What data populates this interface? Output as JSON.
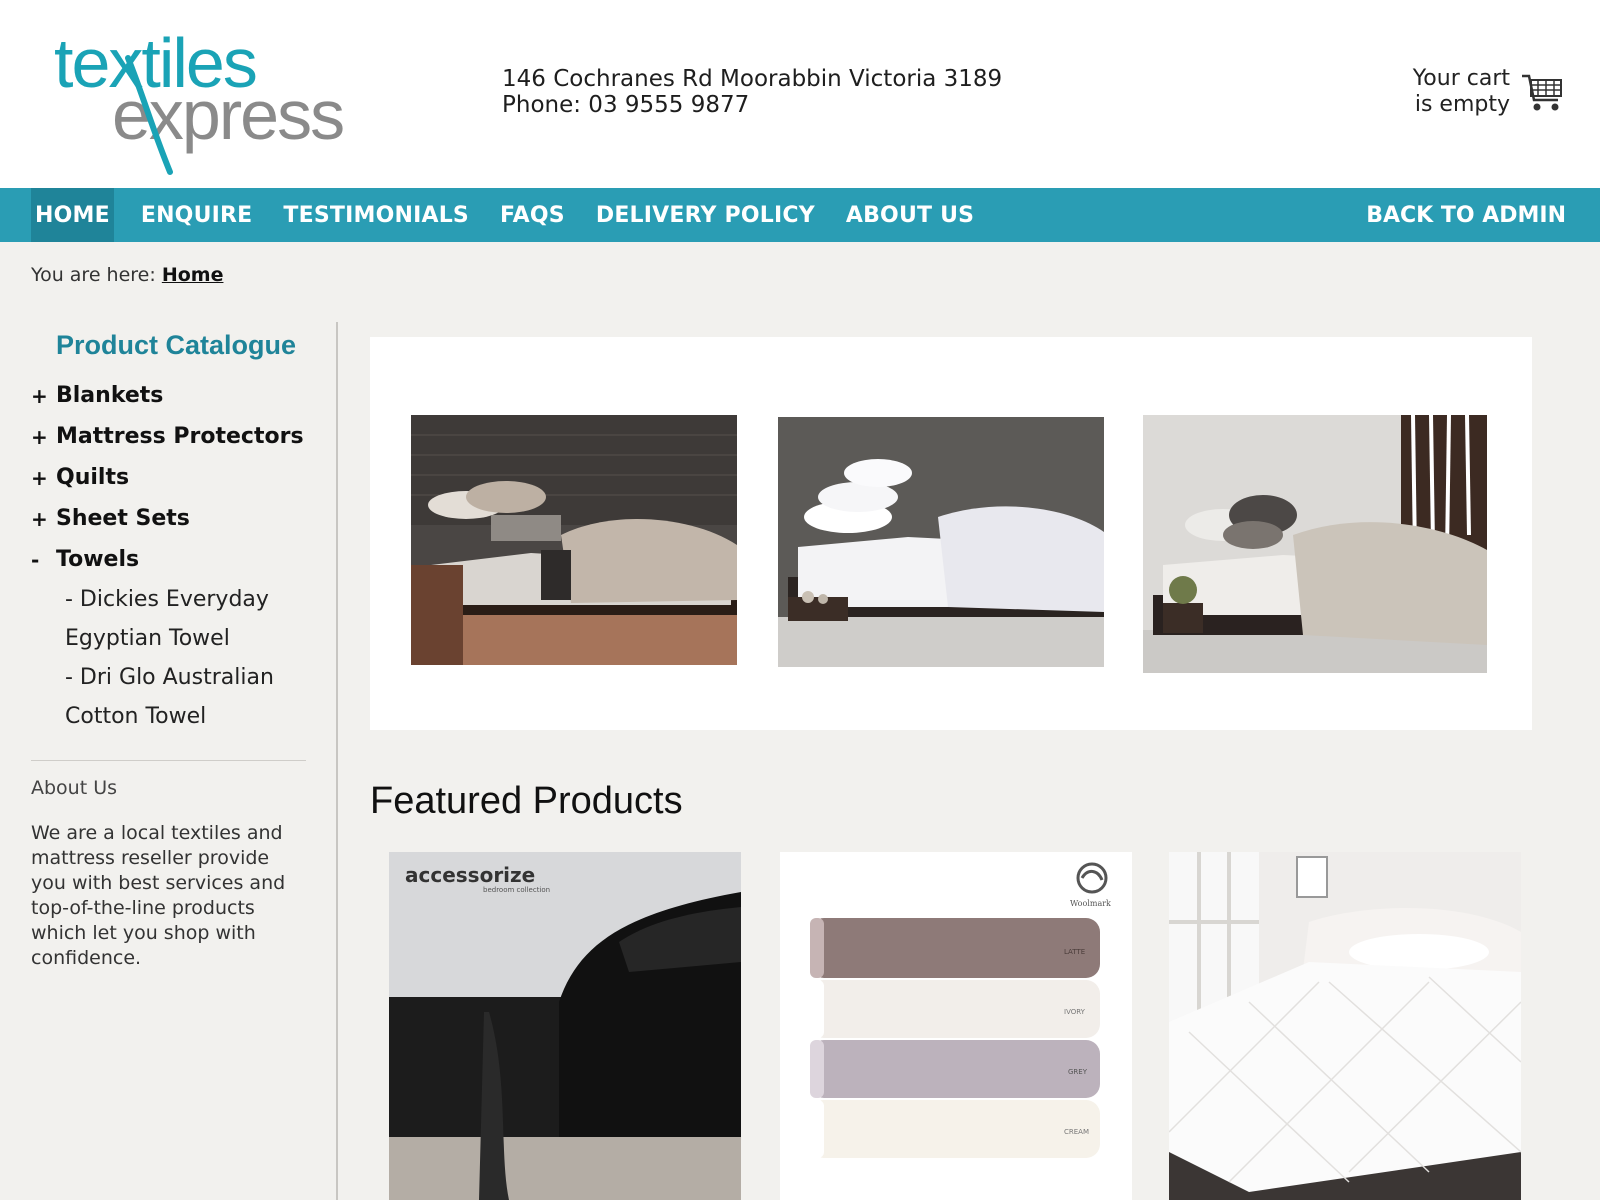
{
  "header": {
    "logo_line1": "textiles",
    "logo_line2": "express",
    "address": "146 Cochranes Rd Moorabbin Victoria 3189",
    "phone": "Phone: 03 9555 9877",
    "cart_line1": "Your cart",
    "cart_line2": "is empty"
  },
  "nav": {
    "items": [
      "HOME",
      "ENQUIRE",
      "TESTIMONIALS",
      "FAQS",
      "DELIVERY POLICY",
      "ABOUT US"
    ],
    "active": "HOME",
    "admin": "BACK TO ADMIN"
  },
  "breadcrumb": {
    "prefix": "You are here:",
    "current": "Home"
  },
  "sidebar": {
    "title": "Product Catalogue",
    "categories": [
      {
        "sign": "+",
        "label": "Blankets"
      },
      {
        "sign": "+",
        "label": "Mattress Protectors"
      },
      {
        "sign": "+",
        "label": "Quilts"
      },
      {
        "sign": "+",
        "label": "Sheet Sets"
      },
      {
        "sign": "-",
        "label": "Towels"
      }
    ],
    "subcategories": [
      {
        "l1": "- Dickies Everyday",
        "l2": "Egyptian Towel"
      },
      {
        "l1": "- Dri Glo Australian",
        "l2": "Cotton Towel"
      }
    ],
    "about_title": "About Us",
    "about_text": "We are a local textiles and mattress reseller provide you with best services and top-of-the-line products which let you shop with confidence."
  },
  "main": {
    "featured_title": "Featured Products",
    "product1_brand": "accessorize",
    "product1_sub": "bedroom collection",
    "product2_badge": "Woolmark",
    "product2_labels": [
      "LATTE",
      "IVORY",
      "GREY",
      "CREAM"
    ]
  },
  "colors": {
    "accent": "#2a9db4",
    "accent_dark": "#1f8499",
    "logo_teal": "#1aa3b6",
    "logo_grey": "#8a8a8a",
    "background": "#f2f1ee"
  }
}
